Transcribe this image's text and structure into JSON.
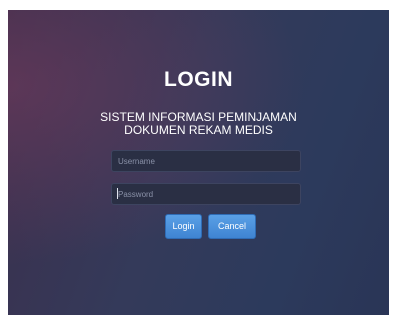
{
  "login": {
    "title": "LOGIN",
    "subtitle_line1": "SISTEM INFORMASI PEMINJAMAN",
    "subtitle_line2": "DOKUMEN REKAM MEDIS",
    "username": {
      "value": "",
      "placeholder": "Username"
    },
    "password": {
      "value": "",
      "placeholder": "Password"
    },
    "login_label": "Login",
    "cancel_label": "Cancel"
  },
  "colors": {
    "background": "#343a5a",
    "button": "#4a8fdb",
    "text": "#ffffff"
  }
}
